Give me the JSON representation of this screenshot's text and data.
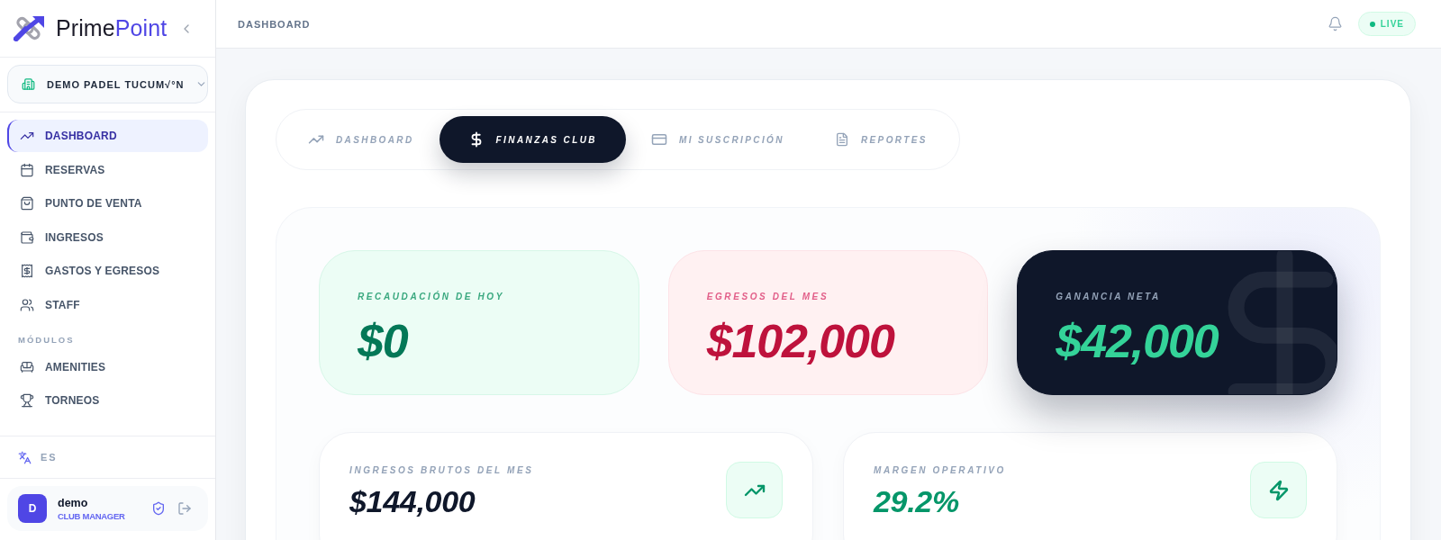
{
  "sidebar": {
    "logo": {
      "text_start": "Prime",
      "text_end": "Point"
    },
    "club_selector": {
      "value": "DEMO PADEL TUCUM√°N"
    },
    "nav": [
      {
        "items": [
          {
            "label": "DASHBOARD",
            "selected": true
          },
          {
            "label": "RESERVAS",
            "selected": false
          },
          {
            "label": "PUNTO DE VENTA",
            "selected": false
          },
          {
            "label": "INGRESOS",
            "selected": false
          },
          {
            "label": "GASTOS Y EGRESOS",
            "selected": false
          },
          {
            "label": "STAFF",
            "selected": false
          }
        ]
      },
      {
        "title": "MÓDULOS",
        "items": [
          {
            "label": "AMENITIES",
            "selected": false
          },
          {
            "label": "TORNEOS",
            "selected": false
          }
        ]
      }
    ],
    "language": "ES",
    "user": {
      "initial": "D",
      "name": "demo",
      "role": "CLUB MANAGER"
    }
  },
  "header": {
    "title": "DASHBOARD",
    "status": "LIVE"
  },
  "tabs": [
    {
      "label": "DASHBOARD",
      "selected": false
    },
    {
      "label": "FINANZAS CLUB",
      "selected": true
    },
    {
      "label": "MI SUSCRIPCIÓN",
      "selected": false
    },
    {
      "label": "REPORTES",
      "selected": false
    }
  ],
  "stat_cards": [
    {
      "kind": "income",
      "label": "RECAUDACIÓN DE HOY",
      "value": "$0"
    },
    {
      "kind": "expense",
      "label": "EGRESOS DEL MES",
      "value": "$102,000"
    },
    {
      "kind": "net",
      "label": "GANANCIA NETA",
      "value": "$42,000"
    }
  ],
  "summary_cards": [
    {
      "kind": "amount",
      "label": "INGRESOS BRUTOS DEL MES",
      "value": "$144,000"
    },
    {
      "kind": "ratio",
      "label": "MARGEN OPERATIVO",
      "value": "29.2%"
    }
  ]
}
